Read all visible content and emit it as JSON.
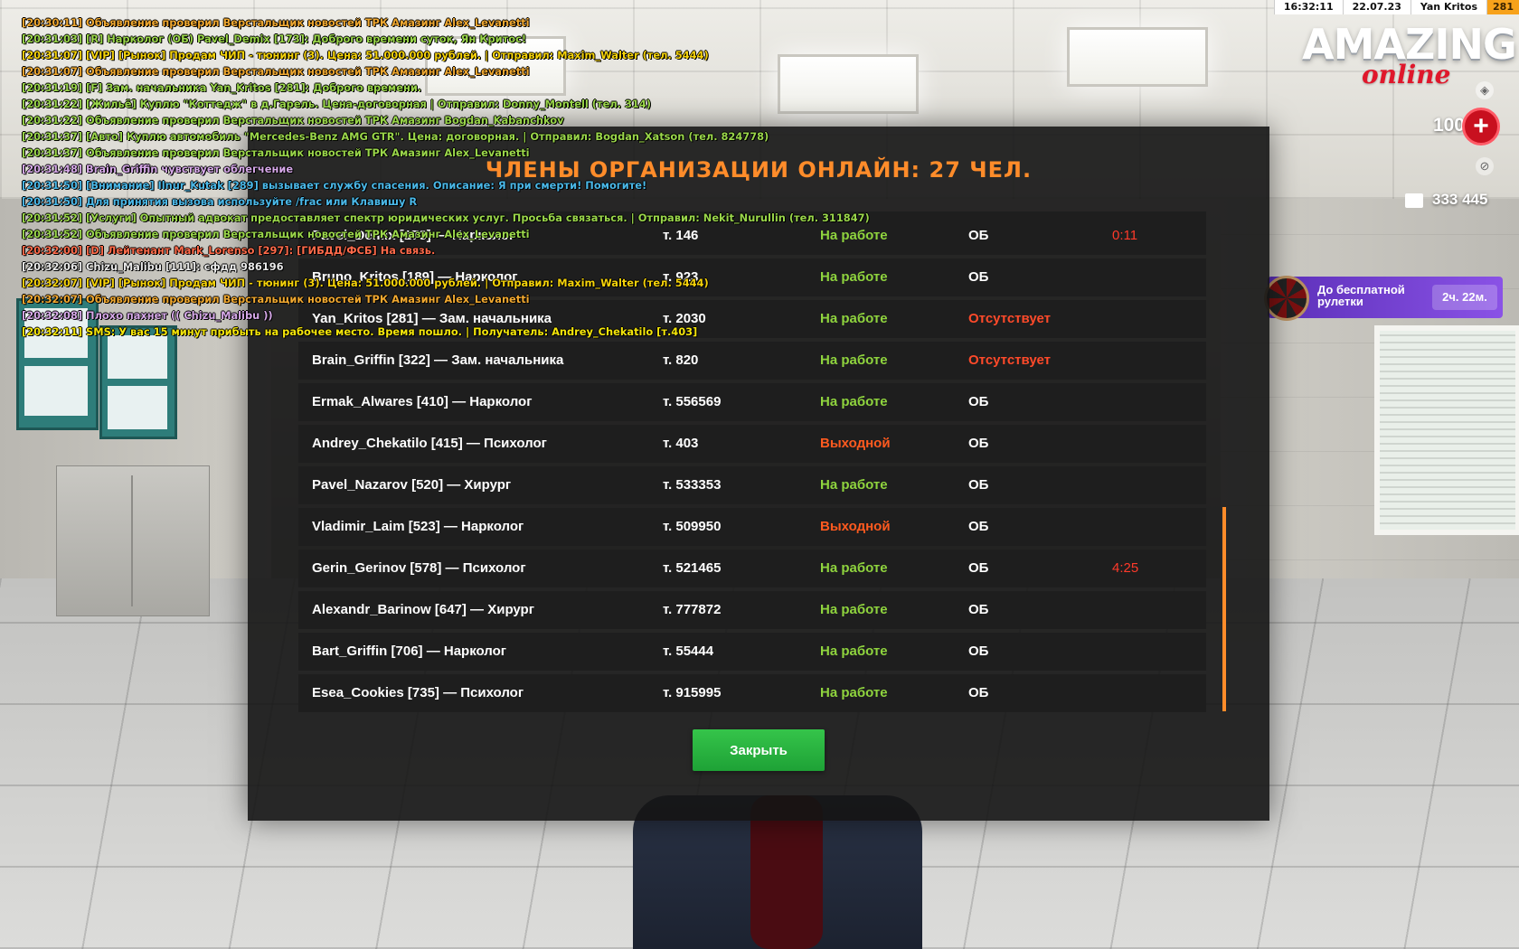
{
  "topbar": {
    "time": "16:32:11",
    "date": "22.07.23",
    "player": "Yan Kritos",
    "level": "281"
  },
  "logo": {
    "main": "AMAZING",
    "sub": "online"
  },
  "hud": {
    "health": "100",
    "money": "333 445",
    "roulette_label": "До бесплатной рулетки",
    "roulette_timer": "2ч. 22м.",
    "icons": {
      "shield": "shield-icon",
      "health": "health-cross-icon",
      "armor": "armor-icon",
      "wallet": "wallet-icon",
      "roulette": "roulette-wheel-icon"
    }
  },
  "chat": [
    {
      "text": "[20:30:11] Объявление проверил Верстальщик новостей ТРК Амазинг Alex_Levanetti",
      "color": "#f0a830"
    },
    {
      "text": "[20:31:03] [R] Нарколог (ОБ) Pavel_Demix [173]: Доброго времени суток, Ян Критос!",
      "color": "#9ad64a"
    },
    {
      "text": "[20:31:07] [VIP] [Рынок] Продам ЧИП - тюнинг (3). Цена: 51.000.000 рублей. | Отправил: Maxim_Walter (тел. 5444)",
      "color": "#f5d20a"
    },
    {
      "text": "[20:31:07] Объявление проверил Верстальщик новостей ТРК Амазинг Alex_Levanetti",
      "color": "#f0a830"
    },
    {
      "text": "[20:31:19] [F] Зам. начальника Yan_Kritos [281]: Доброго времени.",
      "color": "#9ad64a"
    },
    {
      "text": "[20:31:22] [Жильё] Куплю \"Коттедж\" в д.Гарель. Цена-договорная | Отправил: Donny_Montell (тел. 314)",
      "color": "#9ad64a"
    },
    {
      "text": "[20:31:22] Объявление проверил Верстальщик новостей ТРК Амазинг Bogdan_Kabanchkov",
      "color": "#9ad64a"
    },
    {
      "text": "[20:31:37] [Авто] Куплю автомобиль \"Mercedes-Benz AMG GTR\". Цена: договорная. | Отправил: Bogdan_Xatson (тел. 824778)",
      "color": "#9ad64a"
    },
    {
      "text": "[20:31:37] Объявление проверил Верстальщик новостей ТРК Амазинг Alex_Levanetti",
      "color": "#9ad64a"
    },
    {
      "text": "[20:31:48] Brain_Griffin чувствует облегчение",
      "color": "#d6a8e8"
    },
    {
      "text": "[20:31:50] [Внимание] Ilnur_Kutak [289] вызывает службу спасения. Описание: Я при смерти! Помогите!",
      "color": "#4ab8e8"
    },
    {
      "text": "[20:31:50] Для принятия вызова используйте /frac или Клавишу R",
      "color": "#4ab8e8"
    },
    {
      "text": "[20:31:52] [Услуги] Опытный адвокат предоставляет спектр юридических услуг. Просьба связаться. | Отправил: Nekit_Nurullin (тел. 311847)",
      "color": "#9ad64a"
    },
    {
      "text": "[20:31:52] Объявление проверил Верстальщик новостей ТРК Амазинг Alex_Levanetti",
      "color": "#9ad64a"
    },
    {
      "text": "[20:32:00] [D] Лейтенант Mark_Lorenso [297]: [ГИБДД/ФСБ] На связь.",
      "color": "#ff6a4a"
    },
    {
      "text": "[20:32:06] Chizu_Malibu [111]: сфдд 986196",
      "color": "#e8e8e8"
    },
    {
      "text": "[20:32:07] [VIP] [Рынок] Продам ЧИП - тюнинг (3). Цена: 51.000.000 рублей. | Отправил: Maxim_Walter (тел. 5444)",
      "color": "#f5d20a"
    },
    {
      "text": "[20:32:07] Объявление проверил Верстальщик новостей ТРК Амазинг Alex_Levanetti",
      "color": "#f0a830"
    },
    {
      "text": "[20:32:08] Плохо пахнет (( Chizu_Malibu ))",
      "color": "#d6a8e8"
    },
    {
      "text": "[20:32:11] SMS: У вас 15 минут прибыть на рабочее место. Время пошло. | Получатель: Andrey_Chekatilo [т.403]",
      "color": "#f5e60a"
    }
  ],
  "dialog": {
    "title": "ЧЛЕНЫ ОРГАНИЗАЦИИ ОНЛАЙН: 27 ЧЕЛ.",
    "close_label": "Закрыть",
    "rows": [
      {
        "name": "Pavel_Demix [173] — Нарколог",
        "phone": "т. 146",
        "status": "На работе",
        "status_type": "work",
        "state": "ОБ",
        "state_type": "normal",
        "time": "0:11"
      },
      {
        "name": "Bruno_Kritos [189] — Нарколог",
        "phone": "т. 923",
        "status": "На работе",
        "status_type": "work",
        "state": "ОБ",
        "state_type": "normal",
        "time": ""
      },
      {
        "name": "Yan_Kritos [281] — Зам. начальника",
        "phone": "т. 2030",
        "status": "На работе",
        "status_type": "work",
        "state": "Отсутствует",
        "state_type": "absent",
        "time": ""
      },
      {
        "name": "Brain_Griffin [322] — Зам. начальника",
        "phone": "т. 820",
        "status": "На работе",
        "status_type": "work",
        "state": "Отсутствует",
        "state_type": "absent",
        "time": ""
      },
      {
        "name": "Ermak_Alwares [410] — Нарколог",
        "phone": "т. 556569",
        "status": "На работе",
        "status_type": "work",
        "state": "ОБ",
        "state_type": "normal",
        "time": ""
      },
      {
        "name": "Andrey_Chekatilo [415] — Психолог",
        "phone": "т. 403",
        "status": "Выходной",
        "status_type": "off",
        "state": "ОБ",
        "state_type": "normal",
        "time": ""
      },
      {
        "name": "Pavel_Nazarov [520] — Хирург",
        "phone": "т. 533353",
        "status": "На работе",
        "status_type": "work",
        "state": "ОБ",
        "state_type": "normal",
        "time": ""
      },
      {
        "name": "Vladimir_Laim [523] — Нарколог",
        "phone": "т. 509950",
        "status": "Выходной",
        "status_type": "off",
        "state": "ОБ",
        "state_type": "normal",
        "time": ""
      },
      {
        "name": "Gerin_Gerinov [578] — Психолог",
        "phone": "т. 521465",
        "status": "На работе",
        "status_type": "work",
        "state": "ОБ",
        "state_type": "normal",
        "time": "4:25"
      },
      {
        "name": "Alexandr_Barinow [647] — Хирург",
        "phone": "т. 777872",
        "status": "На работе",
        "status_type": "work",
        "state": "ОБ",
        "state_type": "normal",
        "time": ""
      },
      {
        "name": "Bart_Griffin [706] — Нарколог",
        "phone": "т. 55444",
        "status": "На работе",
        "status_type": "work",
        "state": "ОБ",
        "state_type": "normal",
        "time": ""
      },
      {
        "name": "Esea_Cookies [735] — Психолог",
        "phone": "т. 915995",
        "status": "На работе",
        "status_type": "work",
        "state": "ОБ",
        "state_type": "normal",
        "time": ""
      }
    ]
  }
}
